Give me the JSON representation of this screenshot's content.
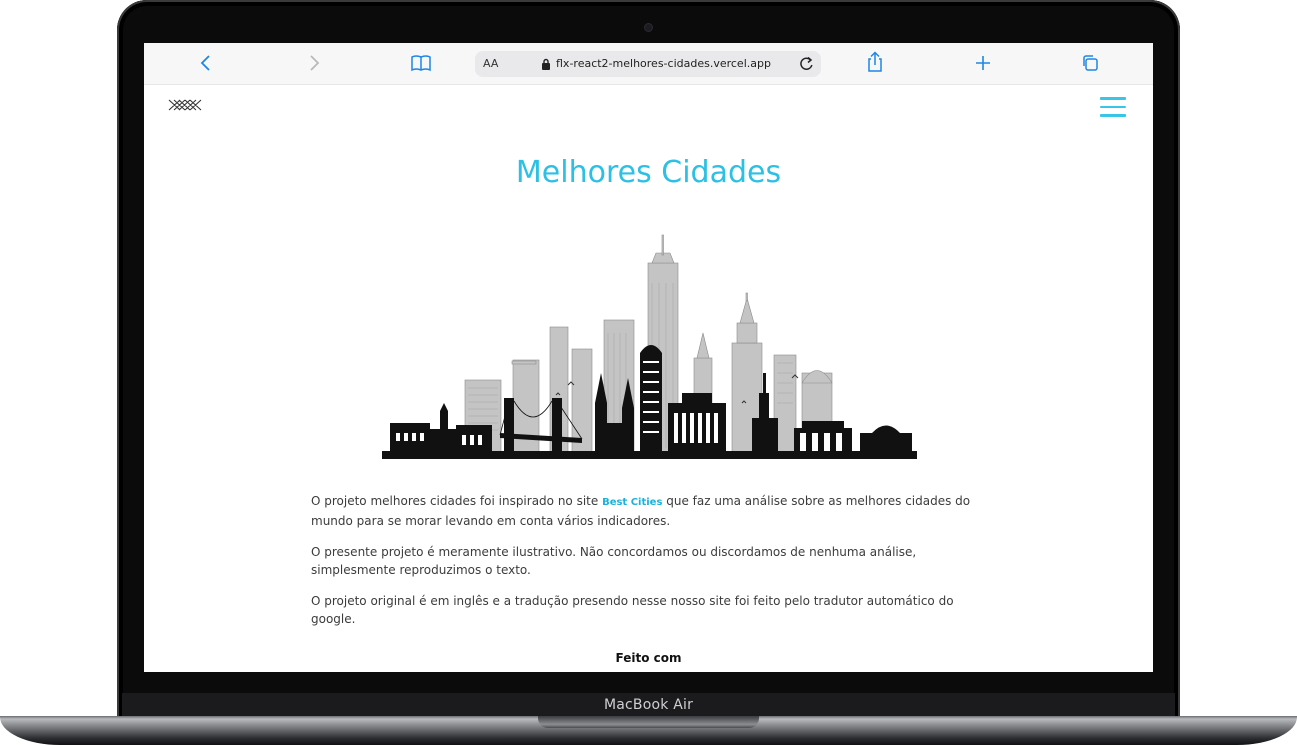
{
  "browser": {
    "address_prefix": "AA",
    "url": "flx-react2-melhores-cidades.vercel.app"
  },
  "page": {
    "title": "Melhores Cidades",
    "paragraph1_before": "O projeto melhores cidades foi inspirado no site ",
    "paragraph1_link": "Best Cities",
    "paragraph1_after": " que faz uma análise sobre as melhores cidades do mundo para se morar levando em conta vários indicadores.",
    "paragraph2": "O presente projeto é meramente ilustrativo. Não concordamos ou discordamos de nenhuma análise, simplesmente reproduzimos o texto.",
    "paragraph3": "O projeto original é em inglês e a tradução presendo nesse nosso site foi feito pelo tradutor automático do google.",
    "footer": "Feito com"
  },
  "device": {
    "label": "MacBook Air"
  },
  "colors": {
    "accent": "#2bc0e4",
    "link": "#1ab2dc",
    "browser_blue": "#1e86e6"
  },
  "icons": [
    "back-icon",
    "forward-icon",
    "bookmarks-icon",
    "lock-icon",
    "reload-icon",
    "share-icon",
    "new-tab-icon",
    "tabs-icon",
    "menu-icon"
  ]
}
